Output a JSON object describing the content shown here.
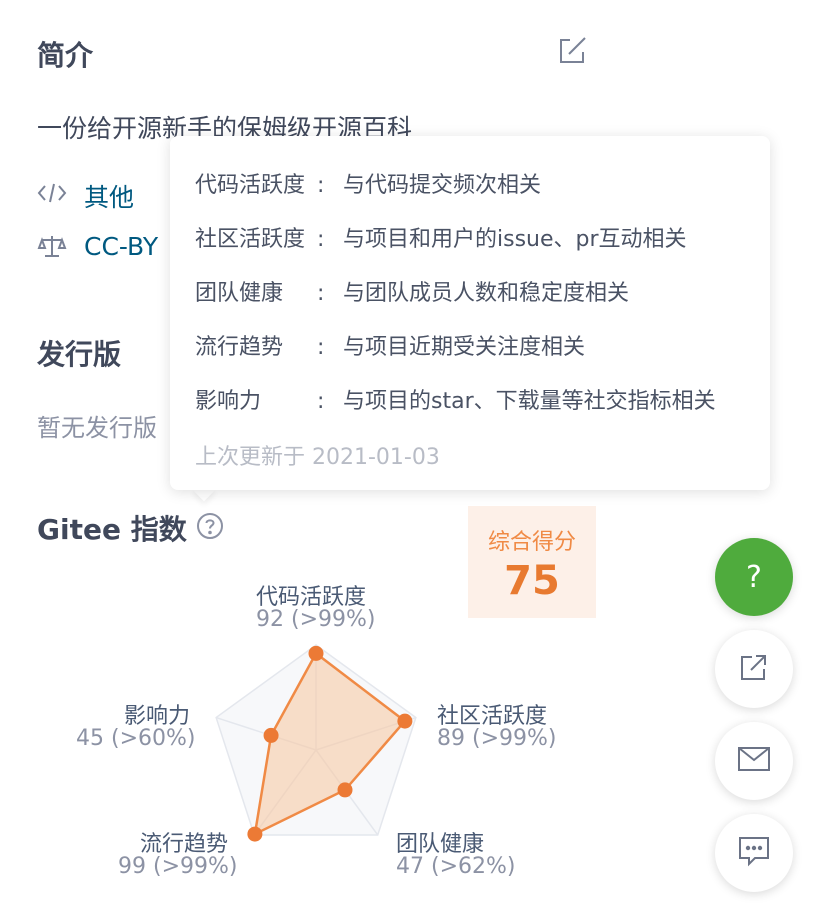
{
  "intro": {
    "title": "简介",
    "edit_icon": "edit-icon",
    "description": "一份给开源新手的保姆级开源百科",
    "language_icon": "code-icon",
    "language": "其他",
    "license_icon": "scale-icon",
    "license": "CC-BY"
  },
  "releases": {
    "title": "发行版",
    "empty_text": "暂无发行版"
  },
  "gitee_index": {
    "title": "Gitee 指数",
    "help_icon": "question-circle-icon",
    "tooltip": {
      "rows": [
        {
          "key": "代码活跃度",
          "sep": ":",
          "value": "与代码提交频次相关"
        },
        {
          "key": "社区活跃度",
          "sep": ":",
          "value": "与项目和用户的issue、pr互动相关"
        },
        {
          "key": "团队健康",
          "sep": ":",
          "value": "与团队成员人数和稳定度相关"
        },
        {
          "key": "流行趋势",
          "sep": ":",
          "value": "与项目近期受关注度相关"
        },
        {
          "key": "影响力",
          "sep": ":",
          "value": "与项目的star、下载量等社交指标相关"
        }
      ],
      "updated": "上次更新于 2021-01-03"
    },
    "score_label": "综合得分",
    "score_value": "75"
  },
  "chart_data": {
    "type": "radar",
    "max": 100,
    "axes": [
      {
        "name": "代码活跃度",
        "value": 92,
        "percentile": "92 (>99%)"
      },
      {
        "name": "社区活跃度",
        "value": 89,
        "percentile": "89 (>99%)"
      },
      {
        "name": "团队健康",
        "value": 47,
        "percentile": "47 (>62%)"
      },
      {
        "name": "流行趋势",
        "value": 99,
        "percentile": "99 (>99%)"
      },
      {
        "name": "影响力",
        "value": 45,
        "percentile": "45 (>60%)"
      }
    ],
    "series_color": "#f08a45",
    "fill_color": "#f7c79f",
    "grid_color": "#e4e7ed"
  },
  "fab": {
    "help_label": "?",
    "share_icon": "share-icon",
    "mail_icon": "mail-icon",
    "chat_icon": "chat-icon"
  }
}
